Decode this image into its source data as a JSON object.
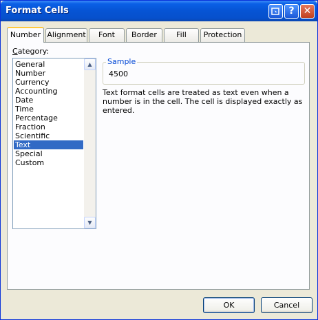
{
  "window": {
    "title": "Format Cells",
    "controls": {
      "help_label": "?",
      "close_label": "✕"
    }
  },
  "tabs": [
    {
      "label": "Number",
      "active": true
    },
    {
      "label": "Alignment",
      "active": false
    },
    {
      "label": "Font",
      "active": false
    },
    {
      "label": "Border",
      "active": false
    },
    {
      "label": "Fill",
      "active": false
    },
    {
      "label": "Protection",
      "active": false
    }
  ],
  "category": {
    "label_prefix": "C",
    "label_rest": "ategory:",
    "items": [
      "General",
      "Number",
      "Currency",
      "Accounting",
      "Date",
      "Time",
      "Percentage",
      "Fraction",
      "Scientific",
      "Text",
      "Special",
      "Custom"
    ],
    "selected": "Text"
  },
  "sample": {
    "legend": "Sample",
    "value": "4500"
  },
  "description": "Text format cells are treated as text even when a number is in the cell.  The cell is displayed exactly as entered.",
  "buttons": {
    "ok": "OK",
    "cancel": "Cancel"
  }
}
